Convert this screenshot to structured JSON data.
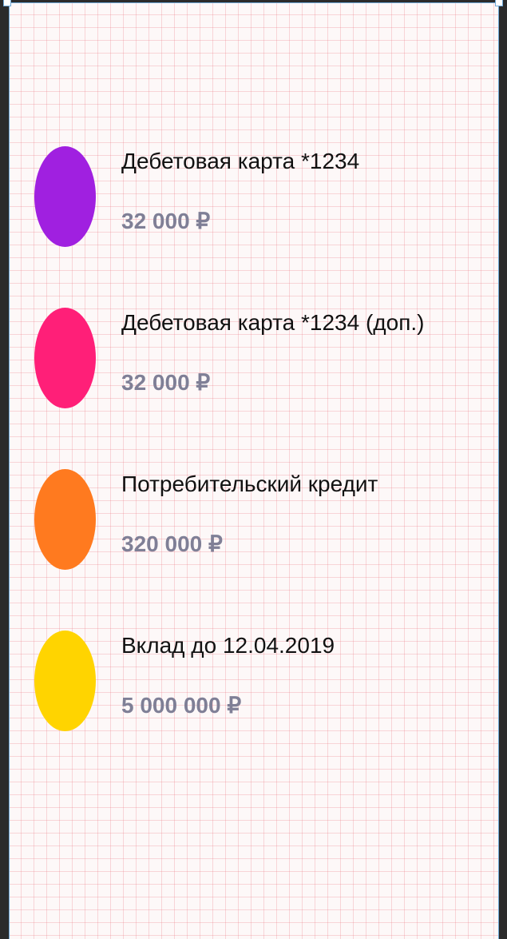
{
  "accounts": [
    {
      "name": "Дебетовая карта *1234",
      "amount": "32 000 ₽",
      "color": "#a020e0"
    },
    {
      "name": "Дебетовая карта *1234 (доп.)",
      "amount": "32 000 ₽",
      "color": "#ff1f78"
    },
    {
      "name": "Потребительский кредит",
      "amount": "320 000 ₽",
      "color": "#ff7a1f"
    },
    {
      "name": "Вклад до 12.04.2019",
      "amount": "5 000 000 ₽",
      "color": "#ffd400"
    }
  ]
}
